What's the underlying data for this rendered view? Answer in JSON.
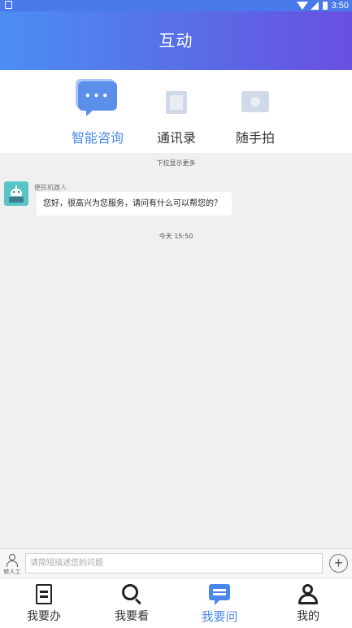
{
  "status_bar": {
    "time": "3:50"
  },
  "header": {
    "title": "互动"
  },
  "tabs": [
    {
      "label": "智能咨询",
      "icon": "chat-bubble-icon",
      "active": true
    },
    {
      "label": "通讯录",
      "icon": "contacts-book-icon",
      "active": false
    },
    {
      "label": "随手拍",
      "icon": "camera-icon",
      "active": false
    }
  ],
  "chat": {
    "pull_hint": "下拉显示更多",
    "bot_name": "便民机器人",
    "message": "您好，很高兴为您服务，请问有什么可以帮您的？",
    "timestamp": "今天 15:50"
  },
  "input_bar": {
    "to_human_label": "转人工",
    "placeholder": "请简短描述您的问题",
    "value": ""
  },
  "bottom_nav": [
    {
      "label": "我要办",
      "icon": "document-icon",
      "active": false
    },
    {
      "label": "我要看",
      "icon": "search-icon",
      "active": false
    },
    {
      "label": "我要问",
      "icon": "chat-icon",
      "active": true
    },
    {
      "label": "我的",
      "icon": "user-icon",
      "active": false
    }
  ],
  "colors": {
    "accent": "#4a87e8",
    "header_start": "#4c8df3",
    "header_end": "#6a4fe0"
  }
}
